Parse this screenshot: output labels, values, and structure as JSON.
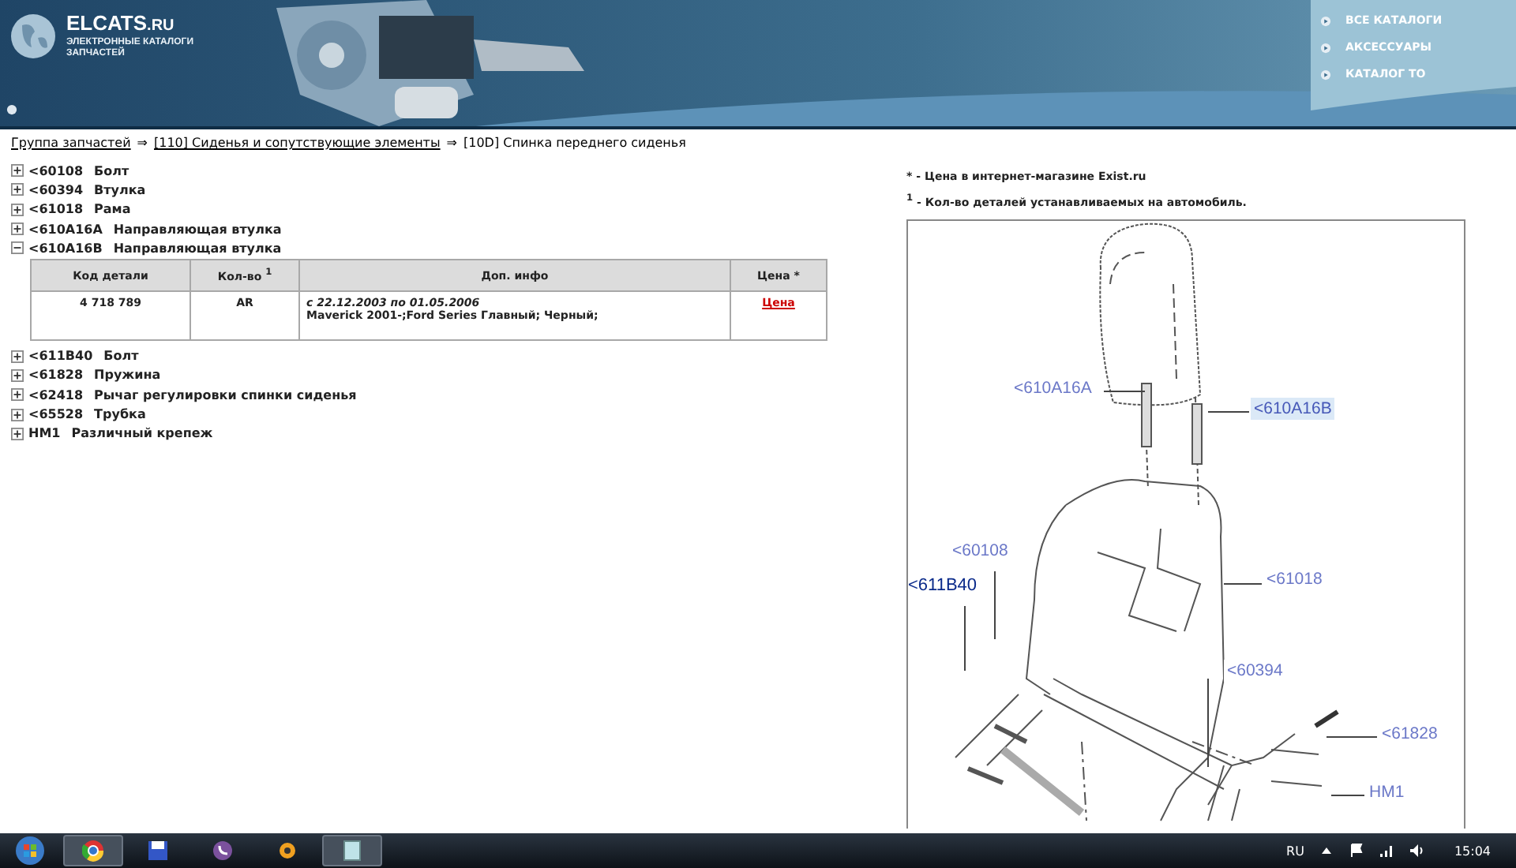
{
  "header": {
    "logo": {
      "title": "ELCATS",
      "suffix": ".RU",
      "subtitle_1": "ЭЛЕКТРОННЫЕ КАТАЛОГИ",
      "subtitle_2": "ЗАПЧАСТЕЙ"
    },
    "menu": [
      "ВСЕ КАТАЛОГИ",
      "АКСЕССУАРЫ",
      "КАТАЛОГ ТО"
    ]
  },
  "breadcrumb": [
    {
      "label": "Группа запчастей",
      "link": true
    },
    {
      "label": "[110] Сиденья и сопутствующие элементы",
      "link": true
    },
    {
      "label": "[10D] Спинка переднего сиденья",
      "link": false
    }
  ],
  "breadcrumb_separator": "⇒",
  "parts": [
    {
      "code": "<60108",
      "name": "Болт",
      "expanded": false
    },
    {
      "code": "<60394",
      "name": "Втулка",
      "expanded": false
    },
    {
      "code": "<61018",
      "name": "Рама",
      "expanded": false
    },
    {
      "code": "<610A16A",
      "name": "Направляющая втулка",
      "expanded": false
    },
    {
      "code": "<610A16B",
      "name": "Направляющая втулка",
      "expanded": true,
      "details": {
        "columns": [
          "Код детали",
          "Кол-во $^{1}$",
          "Доп. инфо",
          "Цена *"
        ],
        "rows": [
          {
            "code": "4 718 789",
            "qty": "AR",
            "dates": "с 22.12.2003 по 01.05.2006",
            "info": "Maverick 2001-;Ford Series Главный; Черный;",
            "price": "Цена"
          }
        ]
      }
    },
    {
      "code": "<611B40",
      "name": "Болт",
      "expanded": false
    },
    {
      "code": "<61828",
      "name": "Пружина",
      "expanded": false
    },
    {
      "code": "<62418",
      "name": "Рычаг регулировки спинки сиденья",
      "expanded": false
    },
    {
      "code": "<65528",
      "name": "Трубка",
      "expanded": false
    },
    {
      "code": "HM1",
      "name": "Различный крепеж",
      "expanded": false
    }
  ],
  "notes": [
    {
      "mark": "*",
      "text": " - Цена в интернет-магазине Exist.ru"
    },
    {
      "mark": "1",
      "text": " - Кол-во деталей устанавливаемых на автомобиль."
    }
  ],
  "diagram": {
    "callouts": [
      {
        "label": "<610A16A",
        "selected": false,
        "emphasis": false
      },
      {
        "label": "<610A16B",
        "selected": true,
        "emphasis": false
      },
      {
        "label": "<60108",
        "selected": false,
        "emphasis": false
      },
      {
        "label": "<611B40",
        "selected": false,
        "emphasis": true
      },
      {
        "label": "<61018",
        "selected": false,
        "emphasis": false
      },
      {
        "label": "<60394",
        "selected": false,
        "emphasis": false
      },
      {
        "label": "<61828",
        "selected": false,
        "emphasis": false
      },
      {
        "label": "HM1",
        "selected": false,
        "emphasis": false
      }
    ]
  },
  "taskbar": {
    "language": "RU",
    "time": "15:04"
  }
}
